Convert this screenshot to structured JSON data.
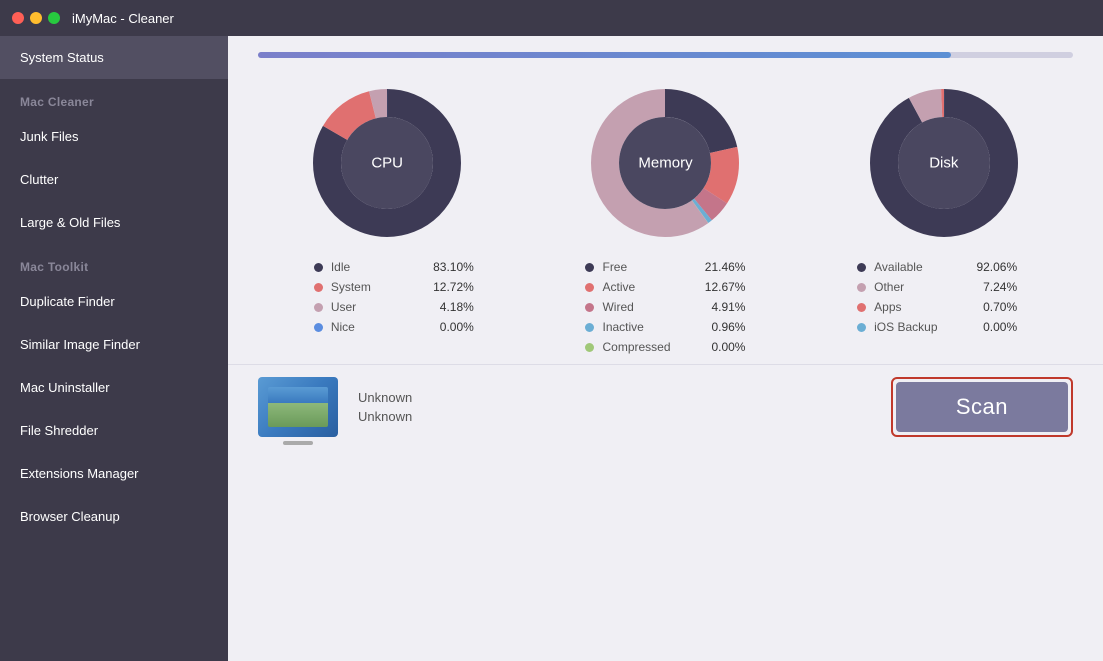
{
  "titlebar": {
    "title": "iMyMac - Cleaner"
  },
  "sidebar": {
    "active_item": "System Status",
    "items": [
      {
        "id": "system-status",
        "label": "System Status",
        "type": "item",
        "active": true
      },
      {
        "id": "mac-cleaner",
        "label": "Mac Cleaner",
        "type": "section"
      },
      {
        "id": "junk-files",
        "label": "Junk Files",
        "type": "item",
        "active": false
      },
      {
        "id": "clutter",
        "label": "Clutter",
        "type": "item",
        "active": false
      },
      {
        "id": "large-old-files",
        "label": "Large & Old Files",
        "type": "item",
        "active": false
      },
      {
        "id": "mac-toolkit",
        "label": "Mac Toolkit",
        "type": "section"
      },
      {
        "id": "duplicate-finder",
        "label": "Duplicate Finder",
        "type": "item",
        "active": false
      },
      {
        "id": "similar-image-finder",
        "label": "Similar Image Finder",
        "type": "item",
        "active": false
      },
      {
        "id": "mac-uninstaller",
        "label": "Mac Uninstaller",
        "type": "item",
        "active": false
      },
      {
        "id": "file-shredder",
        "label": "File Shredder",
        "type": "item",
        "active": false
      },
      {
        "id": "extensions-manager",
        "label": "Extensions Manager",
        "type": "item",
        "active": false
      },
      {
        "id": "browser-cleanup",
        "label": "Browser Cleanup",
        "type": "item",
        "active": false
      }
    ]
  },
  "progress": {
    "fill_percent": 85
  },
  "charts": {
    "cpu": {
      "label": "CPU",
      "segments": [
        {
          "name": "Idle",
          "value": 83.1,
          "color": "#3d3a55",
          "percent": "83.10%"
        },
        {
          "name": "System",
          "value": 12.72,
          "color": "#e07070",
          "percent": "12.72%"
        },
        {
          "name": "User",
          "value": 4.18,
          "color": "#c4a0b0",
          "percent": "4.18%"
        },
        {
          "name": "Nice",
          "value": 0.0,
          "color": "#5b8de0",
          "percent": "0.00%"
        }
      ]
    },
    "memory": {
      "label": "Memory",
      "segments": [
        {
          "name": "Free",
          "value": 21.46,
          "color": "#3d3a55",
          "percent": "21.46%"
        },
        {
          "name": "Active",
          "value": 12.67,
          "color": "#e07070",
          "percent": "12.67%"
        },
        {
          "name": "Wired",
          "value": 4.91,
          "color": "#c4758a",
          "percent": "4.91%"
        },
        {
          "name": "Inactive",
          "value": 0.96,
          "color": "#6baed4",
          "percent": "0.96%"
        },
        {
          "name": "Compressed",
          "value": 0.0,
          "color": "#a0c878",
          "percent": "0.00%"
        }
      ]
    },
    "disk": {
      "label": "Disk",
      "segments": [
        {
          "name": "Available",
          "value": 92.06,
          "color": "#3d3a55",
          "percent": "92.06%"
        },
        {
          "name": "Other",
          "value": 7.24,
          "color": "#c4a0b0",
          "percent": "7.24%"
        },
        {
          "name": "Apps",
          "value": 0.7,
          "color": "#e07070",
          "percent": "0.70%"
        },
        {
          "name": "iOS Backup",
          "value": 0.0,
          "color": "#6baed4",
          "percent": "0.00%"
        }
      ]
    }
  },
  "bottom": {
    "mac_name": "Unknown",
    "mac_os": "Unknown",
    "scan_button_label": "Scan"
  }
}
